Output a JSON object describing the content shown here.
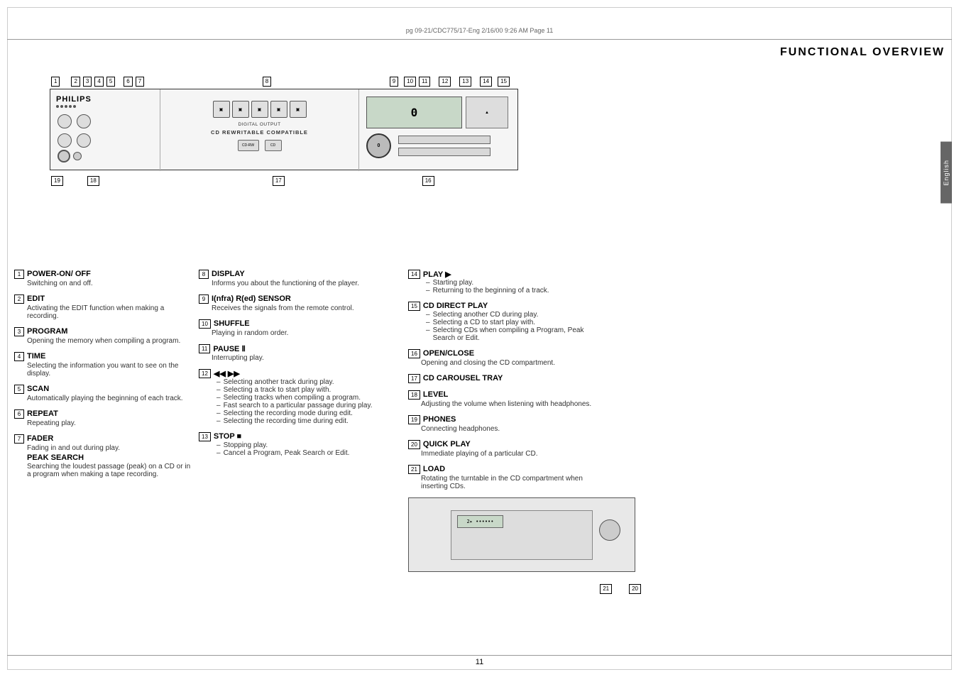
{
  "page": {
    "print_info": "pg 09-21/CDC775/17-Eng   2/16/00   9:26 AM   Page 11",
    "page_number": "11",
    "title": "FUNCTIONAL OVERVIEW",
    "english_tab": "English"
  },
  "diagram": {
    "num_labels_top": [
      "1",
      "2",
      "3",
      "4",
      "5",
      "6",
      "7",
      "8",
      "9",
      "10",
      "11",
      "12",
      "13",
      "14",
      "15"
    ],
    "num_labels_bottom": [
      "19",
      "18",
      "17",
      "16"
    ],
    "device": {
      "brand": "PHILIPS",
      "digital_output": "DIGITAL OUTPUT",
      "cd_rw": "CD REWRITABLE COMPATIBLE",
      "volume_label": "0"
    }
  },
  "descriptions": {
    "col1": [
      {
        "number": "1",
        "title": "POWER-ON/ OFF",
        "lines": [
          "Switching on and off."
        ]
      },
      {
        "number": "2",
        "title": "EDIT",
        "lines": [
          "Activating the EDIT function when making a recording."
        ]
      },
      {
        "number": "3",
        "title": "PROGRAM",
        "lines": [
          "Opening the memory when compiling a program."
        ]
      },
      {
        "number": "4",
        "title": "TIME",
        "lines": [
          "Selecting the information you want to see on the display."
        ]
      },
      {
        "number": "5",
        "title": "SCAN",
        "lines": [
          "Automatically playing the beginning of each track."
        ]
      },
      {
        "number": "6",
        "title": "REPEAT",
        "lines": [
          "Repeating play."
        ]
      },
      {
        "number": "7",
        "title": "FADER",
        "lines": [
          "Fading in and out during play."
        ],
        "subtitle": "PEAK SEARCH",
        "subtitle_lines": [
          "Searching the loudest passage (peak) on a CD or in a program when making a tape recording."
        ]
      }
    ],
    "col2": [
      {
        "number": "8",
        "title": "DISPLAY",
        "lines": [
          "Informs you about the functioning of the player."
        ]
      },
      {
        "number": "9",
        "title": "I(nfra) R(ed) SENSOR",
        "lines": [
          "Receives the signals from the remote control."
        ]
      },
      {
        "number": "10",
        "title": "SHUFFLE",
        "lines": [
          "Playing in random order."
        ]
      },
      {
        "number": "11",
        "title": "PAUSE II",
        "lines": [
          "Interrupting play."
        ]
      },
      {
        "number": "12",
        "title": "◄◄  ►►",
        "dashes": [
          "Selecting another track during play.",
          "Selecting a track to start play with.",
          "Selecting tracks when compiling a program.",
          "Fast search to a particular passage during play.",
          "Selecting the recording mode during edit.",
          "Selecting the recording time during edit."
        ]
      },
      {
        "number": "13",
        "title": "STOP ■",
        "dashes": [
          "Stopping play.",
          "Cancel a Program, Peak Search or Edit."
        ]
      }
    ],
    "col3": [
      {
        "number": "14",
        "title": "PLAY ►",
        "dashes": [
          "Starting play.",
          "Returning to the beginning of a track."
        ]
      },
      {
        "number": "15",
        "title": "CD DIRECT PLAY",
        "dashes": [
          "Selecting another CD during play.",
          "Selecting a CD to start play with.",
          "Selecting CDs when compiling a Program, Peak Search or Edit."
        ]
      },
      {
        "number": "16",
        "title": "OPEN/CLOSE",
        "lines": [
          "Opening and closing the CD compartment."
        ]
      },
      {
        "number": "17",
        "title": "CD CAROUSEL TRAY",
        "lines": []
      },
      {
        "number": "18",
        "title": "LEVEL",
        "lines": [
          "Adjusting the volume when listening with headphones."
        ]
      },
      {
        "number": "19",
        "title": "PHONES",
        "lines": [
          "Connecting headphones."
        ]
      },
      {
        "number": "20",
        "title": "QUICK PLAY",
        "lines": [
          "Immediate playing of a particular CD."
        ]
      },
      {
        "number": "21",
        "title": "LOAD",
        "lines": [
          "Rotating the turntable in the CD compartment when inserting CDs."
        ]
      }
    ]
  },
  "cd_image": {
    "display_text": "2▸ ••••••",
    "label_21": "21",
    "label_20": "20"
  }
}
